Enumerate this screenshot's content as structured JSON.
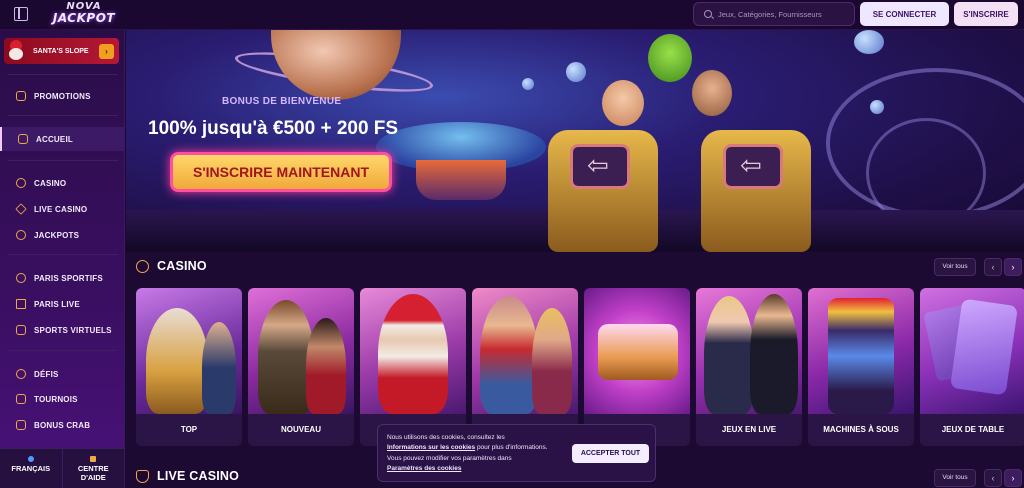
{
  "header": {
    "logo_line1": "NOVA",
    "logo_line2": "JACKPOT",
    "search_placeholder": "Jeux, Catégories, Fournisseurs",
    "login_label": "SE CONNECTER",
    "register_label": "S'INSCRIRE"
  },
  "sidebar": {
    "promo_card": {
      "label": "SANTA'S SLOPE",
      "arrow": "›"
    },
    "items": [
      {
        "label": "PROMOTIONS",
        "icon": "gift-icon"
      },
      {
        "label": "ACCUEIL",
        "icon": "home-icon",
        "active": true
      },
      {
        "label": "CASINO",
        "icon": "casino-chip-icon"
      },
      {
        "label": "LIVE CASINO",
        "icon": "spade-icon"
      },
      {
        "label": "JACKPOTS",
        "icon": "jackpot-icon"
      },
      {
        "label": "PARIS SPORTIFS",
        "icon": "sports-icon"
      },
      {
        "label": "PARIS LIVE",
        "icon": "play-icon"
      },
      {
        "label": "SPORTS VIRTUELS",
        "icon": "gamepad-icon"
      },
      {
        "label": "DÉFIS",
        "icon": "medal-icon"
      },
      {
        "label": "TOURNOIS",
        "icon": "trophy-icon"
      },
      {
        "label": "BONUS CRAB",
        "icon": "crab-icon"
      }
    ],
    "footer": {
      "language": "FRANÇAIS",
      "help_line1": "CENTRE",
      "help_line2": "D'AIDE"
    }
  },
  "hero": {
    "bonus_label": "BONUS DE BIENVENUE",
    "headline": "100% jusqu'à €500 + 200 FS",
    "cta": "S'INSCRIRE MAINTENANT"
  },
  "casino_section": {
    "title": "CASINO",
    "view_all": "Voir tous",
    "prev": "‹",
    "next": "›",
    "cards": [
      {
        "caption": "TOP"
      },
      {
        "caption": "NOUVEAU"
      },
      {
        "caption": ""
      },
      {
        "caption": ""
      },
      {
        "caption": ""
      },
      {
        "caption": "JEUX EN LIVE"
      },
      {
        "caption": "MACHINES À SOUS"
      },
      {
        "caption": "JEUX DE TABLE"
      }
    ]
  },
  "live_casino_section": {
    "title": "LIVE CASINO",
    "view_all": "Voir tous",
    "prev": "‹",
    "next": "›"
  },
  "cookie_banner": {
    "line1": "Nous utilisons des cookies, consultez les",
    "link1": "Informations sur les cookies",
    "line2_rest": " pour plus d'informations.",
    "line3": "Vous pouvez modifier vos paramètres dans",
    "link2": "Paramètres des cookies",
    "accept": "ACCEPTER TOUT"
  },
  "colors": {
    "accent_orange": "#f0a848",
    "background": "#1d0a33",
    "cta_pink": "#ff4fa0"
  }
}
